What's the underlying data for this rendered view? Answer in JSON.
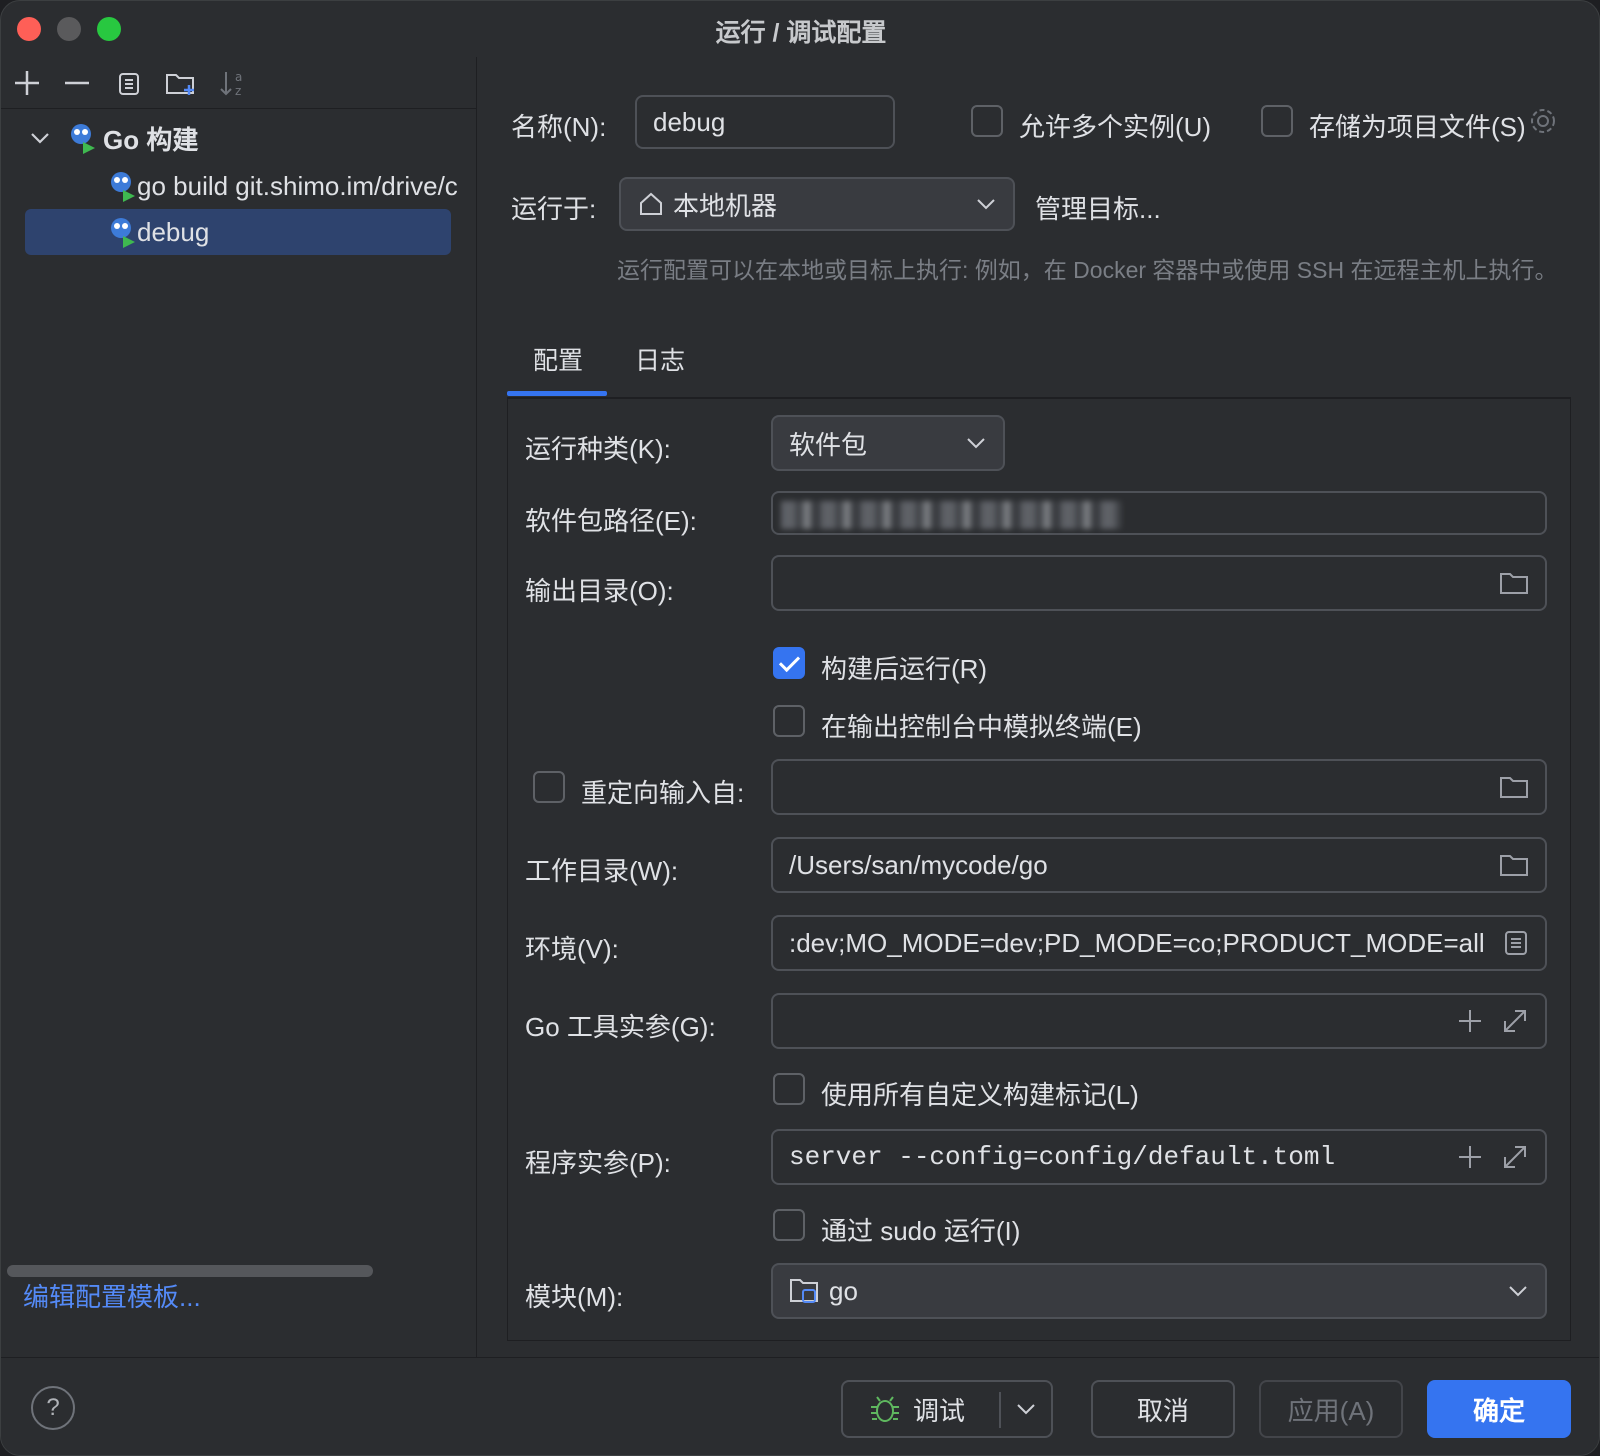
{
  "window": {
    "title": "运行 / 调试配置"
  },
  "sidebar": {
    "group_label": "Go 构建",
    "items": [
      {
        "label": "go build git.shimo.im/drive/c"
      },
      {
        "label": "debug"
      }
    ],
    "edit_templates": "编辑配置模板..."
  },
  "header": {
    "name_label": "名称(N):",
    "name_value": "debug",
    "allow_multi": "允许多个实例(U)",
    "store_project": "存储为项目文件(S)",
    "run_on_label": "运行于:",
    "run_on_value": "本地机器",
    "manage_targets": "管理目标...",
    "hint": "运行配置可以在本地或目标上执行: 例如，在 Docker 容器中或使用 SSH 在远程主机上执行。"
  },
  "tabs": [
    {
      "label": "配置"
    },
    {
      "label": "日志"
    }
  ],
  "form": {
    "run_kind_label": "运行种类(K):",
    "run_kind_value": "软件包",
    "package_path_label": "软件包路径(E):",
    "output_dir_label": "输出目录(O):",
    "run_after_build": "构建后运行(R)",
    "emulate_terminal": "在输出控制台中模拟终端(E)",
    "redirect_input": "重定向输入自:",
    "workdir_label": "工作目录(W):",
    "workdir_value": "/Users/san/mycode/go",
    "env_label": "环境(V):",
    "env_value": ":dev;MO_MODE=dev;PD_MODE=co;PRODUCT_MODE=all",
    "go_tool_args_label": "Go 工具实参(G):",
    "use_custom_tags": "使用所有自定义构建标记(L)",
    "program_args_label": "程序实参(P):",
    "program_args_value": "server --config=config/default.toml",
    "run_sudo": "通过 sudo 运行(I)",
    "module_label": "模块(M):",
    "module_value": "go"
  },
  "footer": {
    "help": "?",
    "debug": "调试",
    "cancel": "取消",
    "apply": "应用(A)",
    "ok": "确定"
  },
  "colors": {
    "accent": "#3574f0",
    "link": "#548af7",
    "selection": "#2e436e"
  }
}
